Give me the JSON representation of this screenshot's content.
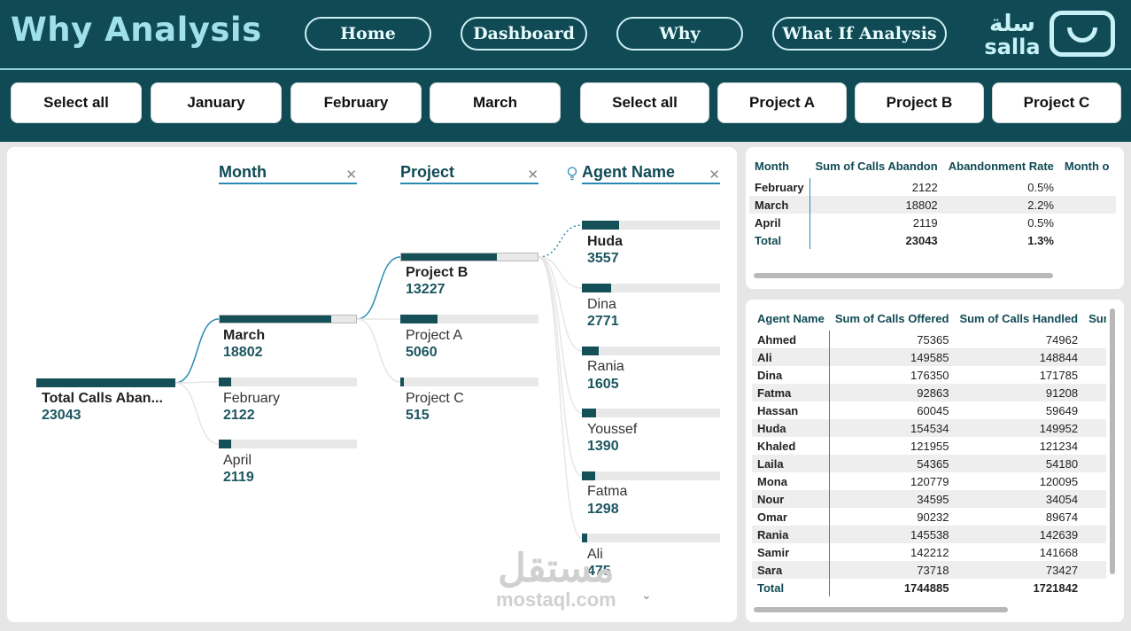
{
  "header": {
    "title": "Why Analysis",
    "nav": [
      "Home",
      "Dashboard",
      "Why",
      "What If Analysis"
    ],
    "logo_arabic": "سلة",
    "logo_latin": "salla"
  },
  "slicers": {
    "months": [
      "Select all",
      "January",
      "February",
      "March"
    ],
    "projects": [
      "Select all",
      "Project A",
      "Project B",
      "Project C"
    ]
  },
  "tree": {
    "columns": [
      "Month",
      "Project",
      "Agent Name"
    ],
    "root": {
      "label": "Total Calls Aban...",
      "value": "23043",
      "share": 1.0
    },
    "months": [
      {
        "label": "March",
        "value": "18802",
        "share": 0.816,
        "selected": true
      },
      {
        "label": "February",
        "value": "2122",
        "share": 0.092,
        "selected": false
      },
      {
        "label": "April",
        "value": "2119",
        "share": 0.092,
        "selected": false
      }
    ],
    "projects": [
      {
        "label": "Project B",
        "value": "13227",
        "share": 0.703,
        "selected": true
      },
      {
        "label": "Project A",
        "value": "5060",
        "share": 0.269,
        "selected": false
      },
      {
        "label": "Project C",
        "value": "515",
        "share": 0.027,
        "selected": false
      }
    ],
    "agents": [
      {
        "label": "Huda",
        "value": "3557",
        "share": 0.269,
        "selected": true
      },
      {
        "label": "Dina",
        "value": "2771",
        "share": 0.21,
        "selected": false
      },
      {
        "label": "Rania",
        "value": "1605",
        "share": 0.121,
        "selected": false
      },
      {
        "label": "Youssef",
        "value": "1390",
        "share": 0.105,
        "selected": false
      },
      {
        "label": "Fatma",
        "value": "1298",
        "share": 0.098,
        "selected": false
      },
      {
        "label": "Ali",
        "value": "475",
        "share": 0.036,
        "selected": false
      }
    ]
  },
  "watermark": {
    "arabic": "مستقل",
    "latin": "mostaql.com"
  },
  "month_table": {
    "headers": [
      "Month",
      "Sum of Calls Abandon",
      "Abandonment Rate",
      "Month o"
    ],
    "rows": [
      [
        "February",
        "2122",
        "0.5%"
      ],
      [
        "March",
        "18802",
        "2.2%"
      ],
      [
        "April",
        "2119",
        "0.5%"
      ]
    ],
    "total": [
      "Total",
      "23043",
      "1.3%"
    ]
  },
  "agent_table": {
    "headers": [
      "Agent Name",
      "Sum of Calls Offered",
      "Sum of Calls Handled",
      "Sun"
    ],
    "rows": [
      [
        "Ahmed",
        "75365",
        "74962"
      ],
      [
        "Ali",
        "149585",
        "148844"
      ],
      [
        "Dina",
        "176350",
        "171785"
      ],
      [
        "Fatma",
        "92863",
        "91208"
      ],
      [
        "Hassan",
        "60045",
        "59649"
      ],
      [
        "Huda",
        "154534",
        "149952"
      ],
      [
        "Khaled",
        "121955",
        "121234"
      ],
      [
        "Laila",
        "54365",
        "54180"
      ],
      [
        "Mona",
        "120779",
        "120095"
      ],
      [
        "Nour",
        "34595",
        "34054"
      ],
      [
        "Omar",
        "90232",
        "89674"
      ],
      [
        "Rania",
        "145538",
        "142639"
      ],
      [
        "Samir",
        "142212",
        "141668"
      ],
      [
        "Sara",
        "73718",
        "73427"
      ]
    ],
    "total": [
      "Total",
      "1744885",
      "1721842"
    ]
  }
}
